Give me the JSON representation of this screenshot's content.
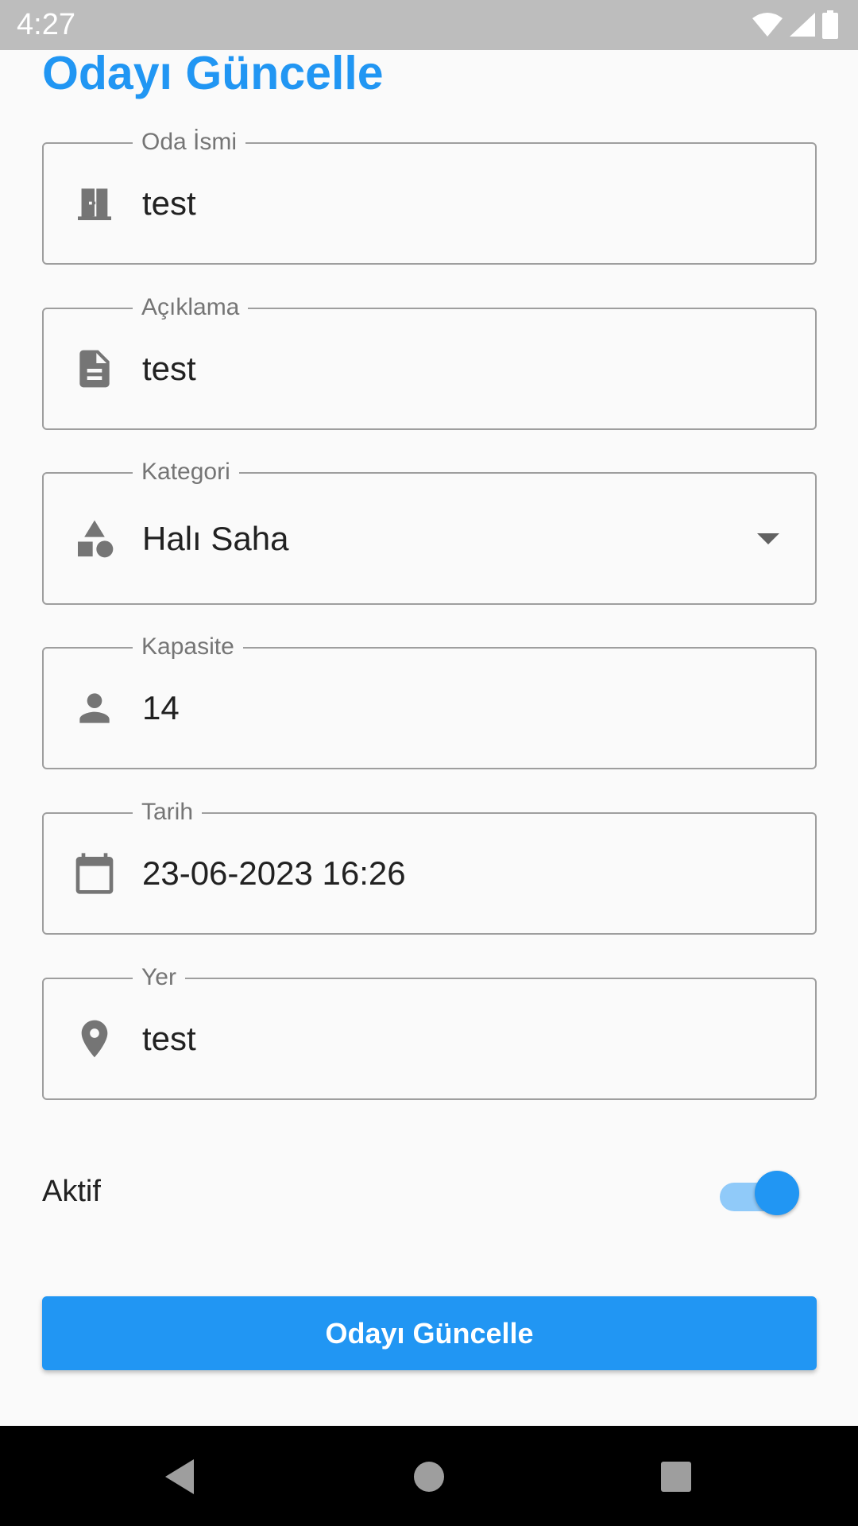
{
  "status_bar": {
    "time": "4:27"
  },
  "page": {
    "title": "Odayı Güncelle"
  },
  "form": {
    "room_name": {
      "label": "Oda İsmi",
      "value": "test",
      "icon": "door-icon"
    },
    "description": {
      "label": "Açıklama",
      "value": "test",
      "icon": "document-icon"
    },
    "category": {
      "label": "Kategori",
      "value": "Halı Saha",
      "icon": "shapes-icon"
    },
    "capacity": {
      "label": "Kapasite",
      "value": "14",
      "icon": "person-icon"
    },
    "date": {
      "label": "Tarih",
      "value": "23-06-2023 16:26",
      "icon": "calendar-icon"
    },
    "location": {
      "label": "Yer",
      "value": "test",
      "icon": "location-pin-icon"
    },
    "active": {
      "label": "Aktif",
      "checked": true
    }
  },
  "actions": {
    "submit_label": "Odayı Güncelle"
  },
  "colors": {
    "accent": "#2196f3",
    "switch_track": "#90caf9",
    "status_bar": "#bdbdbd",
    "nav_bar": "#000000"
  }
}
